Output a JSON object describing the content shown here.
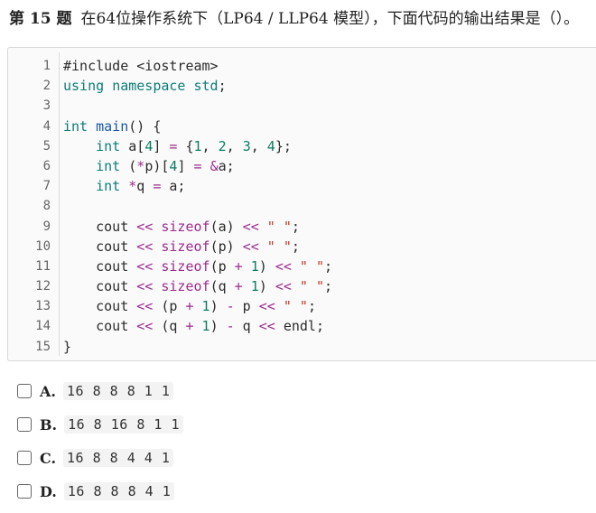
{
  "question": {
    "number": "第 15 题",
    "text": "在64位操作系统下（LP64 / LLP64 模型），下面代码的输出结果是（）。"
  },
  "code": {
    "line_numbers": [
      "1",
      "2",
      "3",
      "4",
      "5",
      "6",
      "7",
      "8",
      "9",
      "10",
      "11",
      "12",
      "13",
      "14",
      "15"
    ],
    "lines": [
      [
        {
          "t": "#include <iostream>",
          "k": "plain"
        }
      ],
      [
        {
          "t": "using",
          "k": "kw"
        },
        {
          "t": " ",
          "k": "plain"
        },
        {
          "t": "namespace",
          "k": "kw"
        },
        {
          "t": " ",
          "k": "plain"
        },
        {
          "t": "std",
          "k": "kw"
        },
        {
          "t": ";",
          "k": "plain"
        }
      ],
      [],
      [
        {
          "t": "int",
          "k": "kw"
        },
        {
          "t": " ",
          "k": "plain"
        },
        {
          "t": "main",
          "k": "fn"
        },
        {
          "t": "() {",
          "k": "plain"
        }
      ],
      [
        {
          "t": "    ",
          "k": "plain"
        },
        {
          "t": "int",
          "k": "kw"
        },
        {
          "t": " a[",
          "k": "plain"
        },
        {
          "t": "4",
          "k": "num"
        },
        {
          "t": "] ",
          "k": "plain"
        },
        {
          "t": "=",
          "k": "op"
        },
        {
          "t": " {",
          "k": "plain"
        },
        {
          "t": "1",
          "k": "num"
        },
        {
          "t": ", ",
          "k": "plain"
        },
        {
          "t": "2",
          "k": "num"
        },
        {
          "t": ", ",
          "k": "plain"
        },
        {
          "t": "3",
          "k": "num"
        },
        {
          "t": ", ",
          "k": "plain"
        },
        {
          "t": "4",
          "k": "num"
        },
        {
          "t": "};",
          "k": "plain"
        }
      ],
      [
        {
          "t": "    ",
          "k": "plain"
        },
        {
          "t": "int",
          "k": "kw"
        },
        {
          "t": " (",
          "k": "plain"
        },
        {
          "t": "*",
          "k": "op"
        },
        {
          "t": "p)[",
          "k": "plain"
        },
        {
          "t": "4",
          "k": "num"
        },
        {
          "t": "] ",
          "k": "plain"
        },
        {
          "t": "=",
          "k": "op"
        },
        {
          "t": " ",
          "k": "plain"
        },
        {
          "t": "&",
          "k": "op"
        },
        {
          "t": "a;",
          "k": "plain"
        }
      ],
      [
        {
          "t": "    ",
          "k": "plain"
        },
        {
          "t": "int",
          "k": "kw"
        },
        {
          "t": " ",
          "k": "plain"
        },
        {
          "t": "*",
          "k": "op"
        },
        {
          "t": "q ",
          "k": "plain"
        },
        {
          "t": "=",
          "k": "op"
        },
        {
          "t": " a;",
          "k": "plain"
        }
      ],
      [],
      [
        {
          "t": "    cout ",
          "k": "plain"
        },
        {
          "t": "<<",
          "k": "op"
        },
        {
          "t": " ",
          "k": "plain"
        },
        {
          "t": "sizeof",
          "k": "op"
        },
        {
          "t": "(a) ",
          "k": "plain"
        },
        {
          "t": "<<",
          "k": "op"
        },
        {
          "t": " ",
          "k": "plain"
        },
        {
          "t": "\" \"",
          "k": "str"
        },
        {
          "t": ";",
          "k": "plain"
        }
      ],
      [
        {
          "t": "    cout ",
          "k": "plain"
        },
        {
          "t": "<<",
          "k": "op"
        },
        {
          "t": " ",
          "k": "plain"
        },
        {
          "t": "sizeof",
          "k": "op"
        },
        {
          "t": "(p) ",
          "k": "plain"
        },
        {
          "t": "<<",
          "k": "op"
        },
        {
          "t": " ",
          "k": "plain"
        },
        {
          "t": "\" \"",
          "k": "str"
        },
        {
          "t": ";",
          "k": "plain"
        }
      ],
      [
        {
          "t": "    cout ",
          "k": "plain"
        },
        {
          "t": "<<",
          "k": "op"
        },
        {
          "t": " ",
          "k": "plain"
        },
        {
          "t": "sizeof",
          "k": "op"
        },
        {
          "t": "(p ",
          "k": "plain"
        },
        {
          "t": "+",
          "k": "op"
        },
        {
          "t": " ",
          "k": "plain"
        },
        {
          "t": "1",
          "k": "num"
        },
        {
          "t": ") ",
          "k": "plain"
        },
        {
          "t": "<<",
          "k": "op"
        },
        {
          "t": " ",
          "k": "plain"
        },
        {
          "t": "\" \"",
          "k": "str"
        },
        {
          "t": ";",
          "k": "plain"
        }
      ],
      [
        {
          "t": "    cout ",
          "k": "plain"
        },
        {
          "t": "<<",
          "k": "op"
        },
        {
          "t": " ",
          "k": "plain"
        },
        {
          "t": "sizeof",
          "k": "op"
        },
        {
          "t": "(q ",
          "k": "plain"
        },
        {
          "t": "+",
          "k": "op"
        },
        {
          "t": " ",
          "k": "plain"
        },
        {
          "t": "1",
          "k": "num"
        },
        {
          "t": ") ",
          "k": "plain"
        },
        {
          "t": "<<",
          "k": "op"
        },
        {
          "t": " ",
          "k": "plain"
        },
        {
          "t": "\" \"",
          "k": "str"
        },
        {
          "t": ";",
          "k": "plain"
        }
      ],
      [
        {
          "t": "    cout ",
          "k": "plain"
        },
        {
          "t": "<<",
          "k": "op"
        },
        {
          "t": " (p ",
          "k": "plain"
        },
        {
          "t": "+",
          "k": "op"
        },
        {
          "t": " ",
          "k": "plain"
        },
        {
          "t": "1",
          "k": "num"
        },
        {
          "t": ") ",
          "k": "plain"
        },
        {
          "t": "-",
          "k": "op"
        },
        {
          "t": " p ",
          "k": "plain"
        },
        {
          "t": "<<",
          "k": "op"
        },
        {
          "t": " ",
          "k": "plain"
        },
        {
          "t": "\" \"",
          "k": "str"
        },
        {
          "t": ";",
          "k": "plain"
        }
      ],
      [
        {
          "t": "    cout ",
          "k": "plain"
        },
        {
          "t": "<<",
          "k": "op"
        },
        {
          "t": " (q ",
          "k": "plain"
        },
        {
          "t": "+",
          "k": "op"
        },
        {
          "t": " ",
          "k": "plain"
        },
        {
          "t": "1",
          "k": "num"
        },
        {
          "t": ") ",
          "k": "plain"
        },
        {
          "t": "-",
          "k": "op"
        },
        {
          "t": " q ",
          "k": "plain"
        },
        {
          "t": "<<",
          "k": "op"
        },
        {
          "t": " endl;",
          "k": "plain"
        }
      ],
      [
        {
          "t": "}",
          "k": "plain"
        }
      ]
    ]
  },
  "options": [
    {
      "letter": "A.",
      "value": "16 8 8 8 1 1"
    },
    {
      "letter": "B.",
      "value": "16 8 16 8 1 1"
    },
    {
      "letter": "C.",
      "value": "16 8 8 4 4 1"
    },
    {
      "letter": "D.",
      "value": "16 8 8 8 4 1"
    }
  ],
  "colors": {
    "keyword": "#0c7d7a",
    "function": "#1a55a8",
    "operator": "#9b2c8f",
    "number": "#0c7d60",
    "string": "#c0392b"
  }
}
